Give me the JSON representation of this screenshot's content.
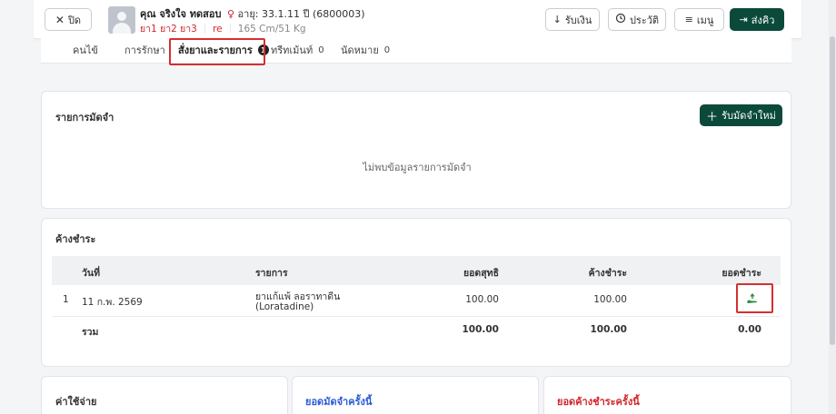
{
  "header": {
    "close_label": "ปิด",
    "patient_name": "คุณ จริงใจ ทดสอบ",
    "gender_icon": "♀",
    "age_label": "อายุ: 33.1.11 ปี",
    "hn": "(6800003)",
    "allergies": "ยา1 ยา2 ยา3",
    "allergy_note": "re",
    "height_weight": "165 Cm/51 Kg",
    "receive_money_label": "รับเงิน",
    "history_label": "ประวัติ",
    "menu_label": "เมนู",
    "send_queue_label": "ส่งคิว"
  },
  "tabs": [
    {
      "label": "คนไข้"
    },
    {
      "label": "การรักษา"
    },
    {
      "label": "สั่งยาและรายการ",
      "badge": "1"
    },
    {
      "label": "ทรีทเม้นท์",
      "badge": "0"
    },
    {
      "label": "นัดหมาย",
      "badge": "0"
    }
  ],
  "deposit": {
    "title": "รายการมัดจำ",
    "add_button": "รับมัดจำใหม่",
    "empty_text": "ไม่พบข้อมูลรายการมัดจำ"
  },
  "outstanding": {
    "title": "ค้างชำระ",
    "columns": [
      "วันที่",
      "รายการ",
      "ยอดสุทธิ",
      "ค้างชำระ",
      "ยอดชำระ"
    ],
    "rows": [
      {
        "no": "1",
        "date": "11 ก.พ. 2569",
        "item_line1": "ยาแก้แพ้ ลอราทาดีน",
        "item_line2": "(Loratadine)",
        "net": "100.00",
        "outstanding": "100.00"
      }
    ],
    "total_label": "รวม",
    "total_net": "100.00",
    "total_outstanding": "100.00",
    "total_paid": "0.00"
  },
  "bottom": {
    "expenses_title": "ค่าใช้จ่าย",
    "deposit_round_title": "ยอดมัดจำครั้งนี้",
    "outstanding_round_title": "ยอดค้างชำระครั้งนี้"
  },
  "colors": {
    "primary_dark": "#0b4a3b",
    "danger": "#d0262c",
    "link_blue": "#2a5bd7",
    "pay_icon_green": "#2e8b3a"
  }
}
